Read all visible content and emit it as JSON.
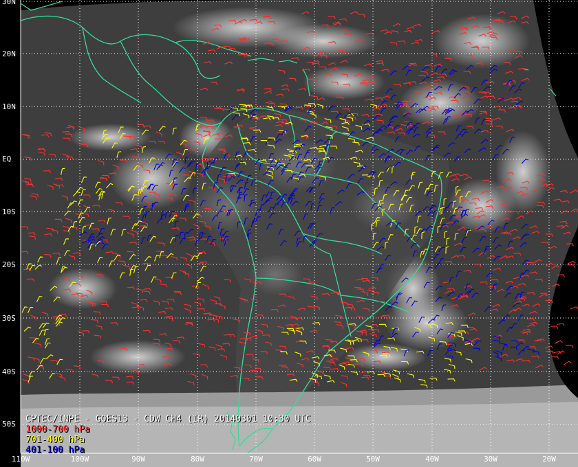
{
  "title": "CPTEC/INPE - GOES13 - CDW CH4 (IR) 20140301 10:30 UTC",
  "legend": [
    {
      "label": "1000-700 hPa",
      "color": "#ff3030"
    },
    {
      "label": "701-400 hPa",
      "color": "#ffff00"
    },
    {
      "label": "401-100 hPa",
      "color": "#0000dd"
    }
  ],
  "lat_labels": [
    "30N",
    "20N",
    "10N",
    "EQ",
    "10S",
    "20S",
    "30S",
    "40S",
    "50S"
  ],
  "lon_labels": [
    "110W",
    "100W",
    "90W",
    "80W",
    "70W",
    "60W",
    "50W",
    "40W",
    "30W",
    "20W"
  ],
  "colors": {
    "coastline": "#33dd99",
    "grid": "#ffffff",
    "background": "#000000"
  }
}
